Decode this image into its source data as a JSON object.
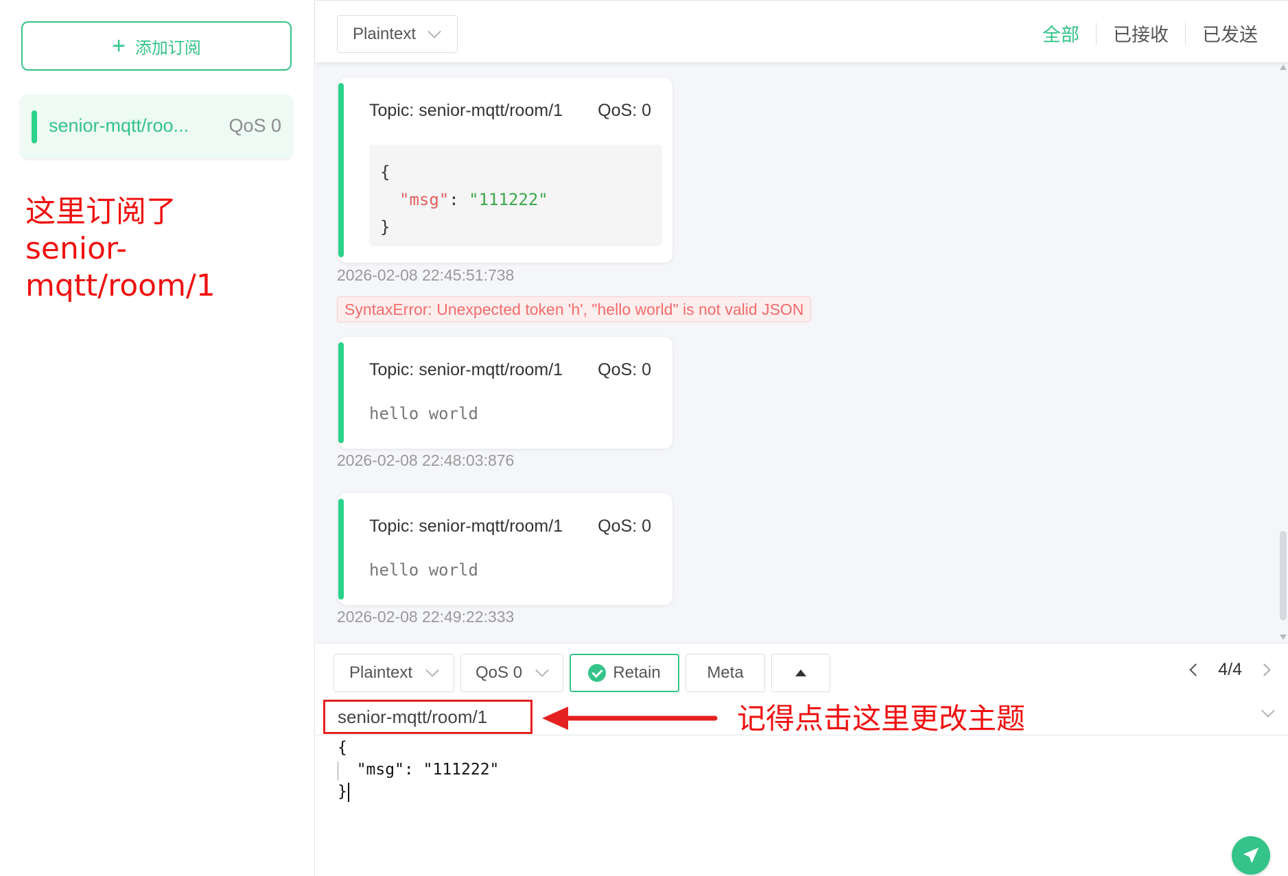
{
  "sidebar": {
    "add_button_label": "添加订阅",
    "subscriptions": [
      {
        "topic": "senior-mqtt/room/1",
        "topic_display": "senior-mqtt/roo...",
        "qos": "QoS 0",
        "color": "#2bd28a"
      }
    ],
    "annotation_line1": "这里订阅了",
    "annotation_line2": "senior-mqtt/room/1"
  },
  "header": {
    "format_select": "Plaintext",
    "filters": [
      {
        "label": "全部",
        "active": true
      },
      {
        "label": "已接收",
        "active": false
      },
      {
        "label": "已发送",
        "active": false
      }
    ]
  },
  "messages": [
    {
      "topic": "Topic: senior-mqtt/room/1",
      "qos": "QoS: 0",
      "json_open": "{",
      "json_key": "\"msg\"",
      "json_colon": ": ",
      "json_value": "\"111222\"",
      "json_close": "}",
      "time": "2026-02-08 22:45:51:738"
    },
    {
      "error": "SyntaxError: Unexpected token 'h', \"hello world\" is not valid JSON",
      "topic": "Topic: senior-mqtt/room/1",
      "qos": "QoS: 0",
      "payload": "hello world",
      "time": "2026-02-08 22:48:03:876"
    },
    {
      "topic": "Topic: senior-mqtt/room/1",
      "qos": "QoS: 0",
      "payload": "hello world",
      "time": "2026-02-08 22:49:22:333"
    }
  ],
  "publish": {
    "format": "Plaintext",
    "qos": "QoS 0",
    "retain_label": "Retain",
    "meta_label": "Meta",
    "pager": "4/4",
    "topic_value": "senior-mqtt/room/1",
    "annotation": "记得点击这里更改主题",
    "payload_line1": "{",
    "payload_line2": "  \"msg\": \"111222\"",
    "payload_line3": "}"
  },
  "colors": {
    "accent": "#34c388",
    "annotation": "#f01010",
    "error_text": "#f36b6b"
  },
  "icons": [
    "plus-icon",
    "chevron-down-icon",
    "check-circle-icon",
    "caret-up-icon",
    "chevron-left-icon",
    "chevron-right-icon",
    "send-icon",
    "arrow-left-annotation"
  ]
}
